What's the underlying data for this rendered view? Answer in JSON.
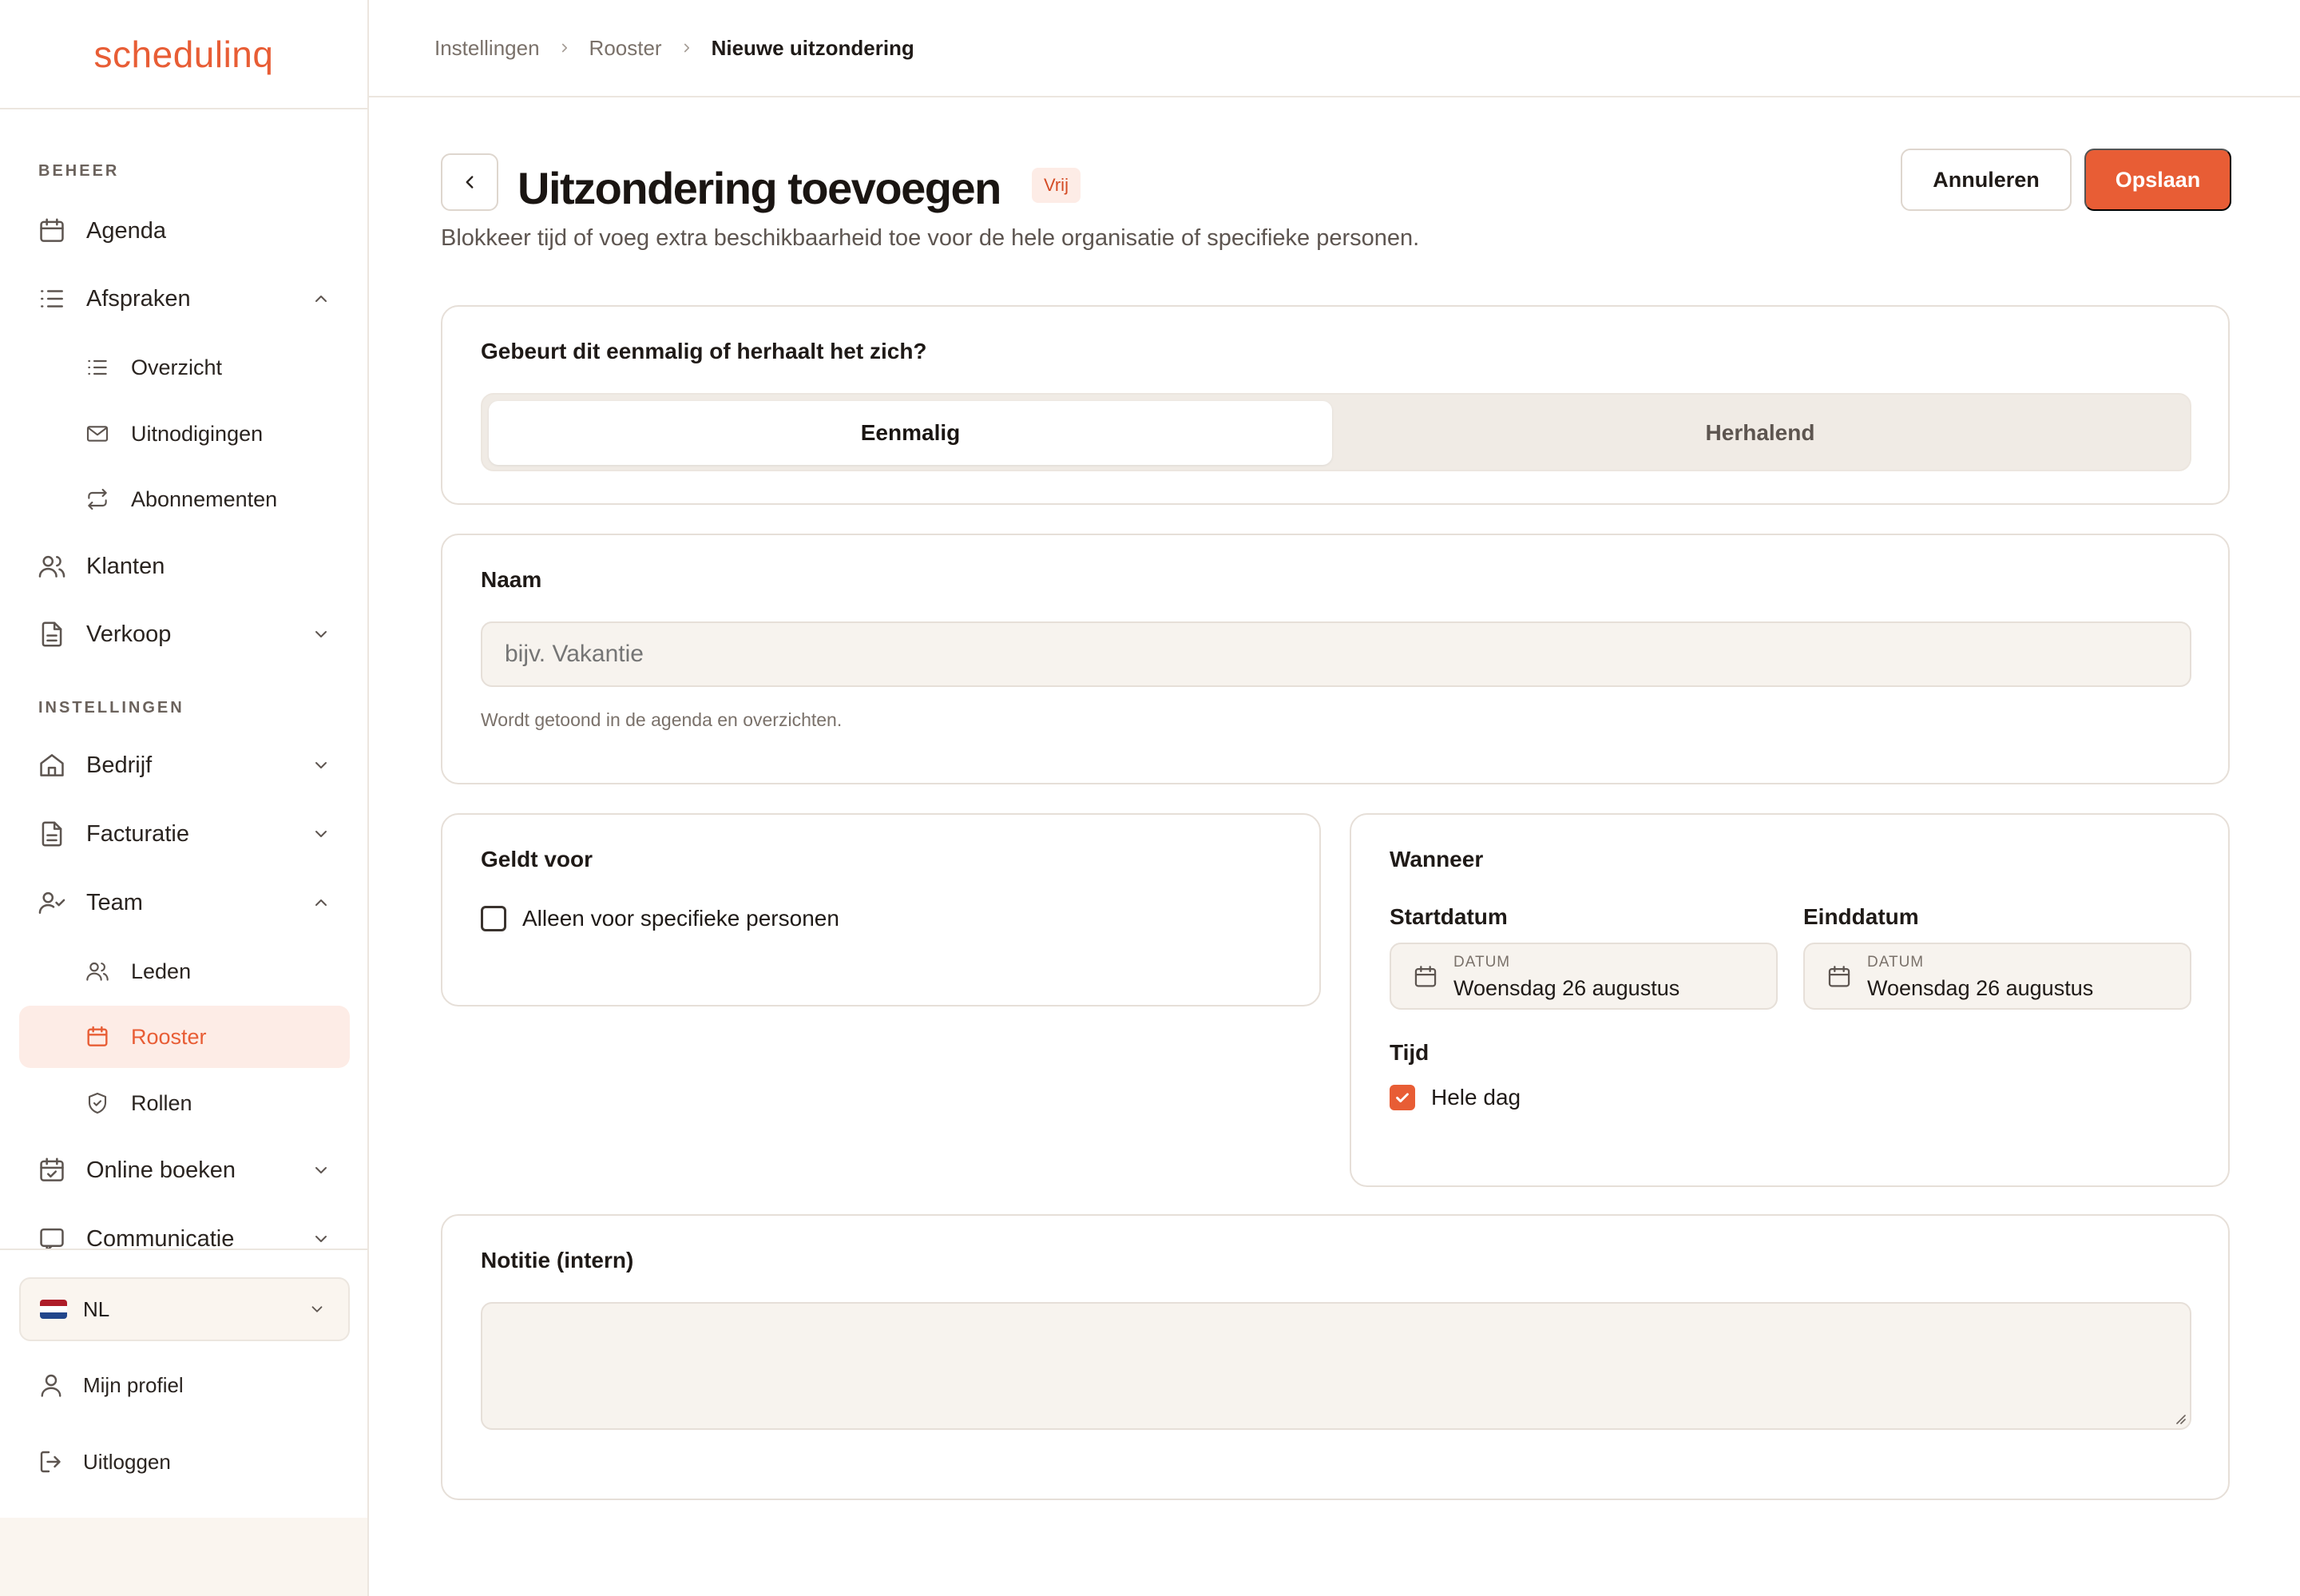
{
  "brand": {
    "logo_text": "schedulinq",
    "accent": "#e85d35"
  },
  "sidebar": {
    "sections": [
      {
        "label": "BEHEER"
      },
      {
        "label": "INSTELLINGEN"
      }
    ],
    "items": {
      "agenda": {
        "label": "Agenda",
        "icon": "calendar-icon"
      },
      "afspraken": {
        "label": "Afspraken",
        "icon": "list-icon",
        "expanded": true
      },
      "overzicht": {
        "label": "Overzicht",
        "icon": "list-icon"
      },
      "uitnodigingen": {
        "label": "Uitnodigingen",
        "icon": "mail-icon"
      },
      "abonnementen": {
        "label": "Abonnementen",
        "icon": "repeat-icon"
      },
      "klanten": {
        "label": "Klanten",
        "icon": "users-icon"
      },
      "verkoop": {
        "label": "Verkoop",
        "icon": "document-icon"
      },
      "bedrijf": {
        "label": "Bedrijf",
        "icon": "home-icon"
      },
      "facturatie": {
        "label": "Facturatie",
        "icon": "document-icon"
      },
      "team": {
        "label": "Team",
        "icon": "user-check-icon",
        "expanded": true
      },
      "leden": {
        "label": "Leden",
        "icon": "users-icon"
      },
      "rooster": {
        "label": "Rooster",
        "icon": "calendar-icon",
        "active": true
      },
      "rollen": {
        "label": "Rollen",
        "icon": "shield-icon"
      },
      "online_boeken": {
        "label": "Online boeken",
        "icon": "calendar-check-icon"
      },
      "communicatie": {
        "label": "Communicatie",
        "icon": "message-icon"
      }
    },
    "footer": {
      "language": {
        "label": "NL",
        "icon": "flag-nl-icon"
      },
      "profile": {
        "label": "Mijn profiel",
        "icon": "user-icon"
      },
      "logout": {
        "label": "Uitloggen",
        "icon": "logout-icon"
      }
    }
  },
  "breadcrumb": {
    "items": [
      "Instellingen",
      "Rooster",
      "Nieuwe uitzondering"
    ]
  },
  "header": {
    "title": "Uitzondering toevoegen",
    "badge": "Vrij",
    "subtitle": "Blokkeer tijd of voeg extra beschikbaarheid toe voor de hele organisatie of specifieke personen.",
    "cancel_label": "Annuleren",
    "save_label": "Opslaan"
  },
  "recurrence": {
    "question": "Gebeurt dit eenmalig of herhaalt het zich?",
    "options": [
      "Eenmalig",
      "Herhalend"
    ],
    "selected": "Eenmalig"
  },
  "name_field": {
    "label": "Naam",
    "placeholder": "bijv. Vakantie",
    "value": "",
    "help": "Wordt getoond in de agenda en overzichten."
  },
  "applies_to": {
    "title": "Geldt voor",
    "checkbox_label": "Alleen voor specifieke personen",
    "checked": false
  },
  "when": {
    "title": "Wanneer",
    "start": {
      "label": "Startdatum",
      "caption": "DATUM",
      "value": "Woensdag 26 augustus"
    },
    "end": {
      "label": "Einddatum",
      "caption": "DATUM",
      "value": "Woensdag 26 augustus"
    },
    "time_label": "Tijd",
    "all_day_label": "Hele dag",
    "all_day_checked": true
  },
  "note": {
    "label": "Notitie (intern)",
    "value": ""
  }
}
